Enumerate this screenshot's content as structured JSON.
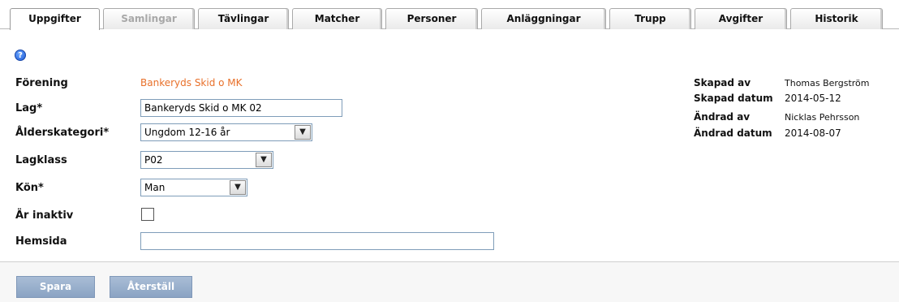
{
  "tabs": [
    {
      "label": "Uppgifter",
      "state": "active"
    },
    {
      "label": "Samlingar",
      "state": "disabled"
    },
    {
      "label": "Tävlingar",
      "state": "normal"
    },
    {
      "label": "Matcher",
      "state": "normal"
    },
    {
      "label": "Personer",
      "state": "normal"
    },
    {
      "label": "Anläggningar",
      "state": "normal"
    },
    {
      "label": "Trupp",
      "state": "normal"
    },
    {
      "label": "Avgifter",
      "state": "normal"
    },
    {
      "label": "Historik",
      "state": "normal"
    }
  ],
  "help_icon": {
    "glyph": "?",
    "icon": "help-icon"
  },
  "form": {
    "forening": {
      "label": "Förening",
      "value": "Bankeryds Skid o MK"
    },
    "lag": {
      "label": "Lag*",
      "value": "Bankeryds Skid o MK 02"
    },
    "alderskategori": {
      "label": "Ålderskategori*",
      "value": "Ungdom 12-16 år"
    },
    "lagklass": {
      "label": "Lagklass",
      "value": "P02"
    },
    "kon": {
      "label": "Kön*",
      "value": "Man"
    },
    "inaktiv": {
      "label": "Är inaktiv",
      "checked": false
    },
    "hemsida": {
      "label": "Hemsida",
      "value": ""
    }
  },
  "meta": {
    "skapad_av": {
      "label": "Skapad av",
      "value": "Thomas Bergström"
    },
    "skapad_datum": {
      "label": "Skapad datum",
      "value": "2014-05-12"
    },
    "andrad_av": {
      "label": "Ändrad av",
      "value": "Nicklas Pehrsson"
    },
    "andrad_datum": {
      "label": "Ändrad datum",
      "value": "2014-08-07"
    }
  },
  "buttons": {
    "save": "Spara",
    "reset": "Återställ"
  },
  "colors": {
    "link": "#e8702a",
    "button": "#8aa3c3"
  }
}
